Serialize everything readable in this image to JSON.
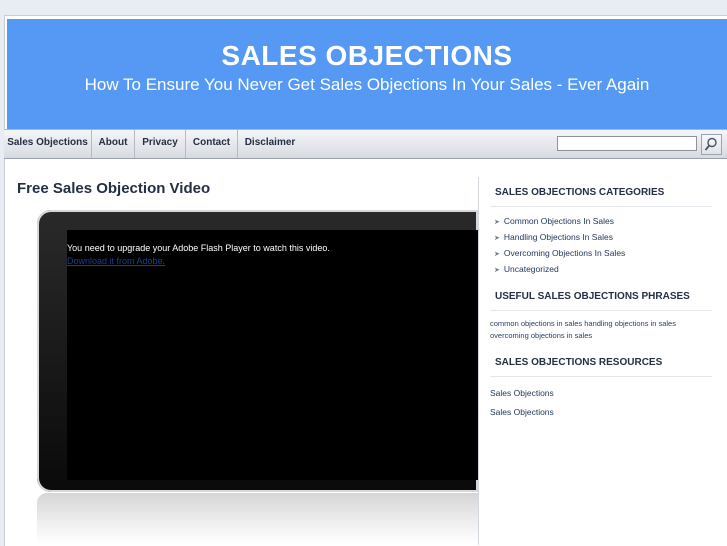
{
  "header": {
    "site_title": "SALES OBJECTIONS",
    "site_description": "How To Ensure You Never Get Sales Objections In Your Sales - Ever Again"
  },
  "nav": {
    "items": [
      {
        "label": "Sales Objections"
      },
      {
        "label": "About"
      },
      {
        "label": "Privacy"
      },
      {
        "label": "Contact"
      },
      {
        "label": "Disclaimer"
      }
    ],
    "search_icon": "magnifier-icon"
  },
  "main": {
    "post_title": "Free Sales Objection Video",
    "flash_message": "You need to upgrade your Adobe Flash Player to watch this video.",
    "flash_link": "Download it from Adobe."
  },
  "sidebar": {
    "categories_title": "SALES OBJECTIONS CATEGORIES",
    "categories": [
      {
        "label": "Common Objections In Sales"
      },
      {
        "label": "Handling Objections In Sales"
      },
      {
        "label": "Overcoming Objections In Sales"
      },
      {
        "label": "Uncategorized"
      }
    ],
    "phrases_title": "USEFUL SALES OBJECTIONS PHRASES",
    "phrases": [
      {
        "label": "common objections in sales"
      },
      {
        "label": "handling objections in sales"
      },
      {
        "label": "overcoming objections in sales"
      }
    ],
    "resources_title": "SALES OBJECTIONS RESOURCES",
    "resources": [
      {
        "label": "Sales Objections"
      },
      {
        "label": "Sales Objections"
      }
    ]
  },
  "colors": {
    "header_bg": "#5599f4",
    "heading_text": "#233044"
  }
}
